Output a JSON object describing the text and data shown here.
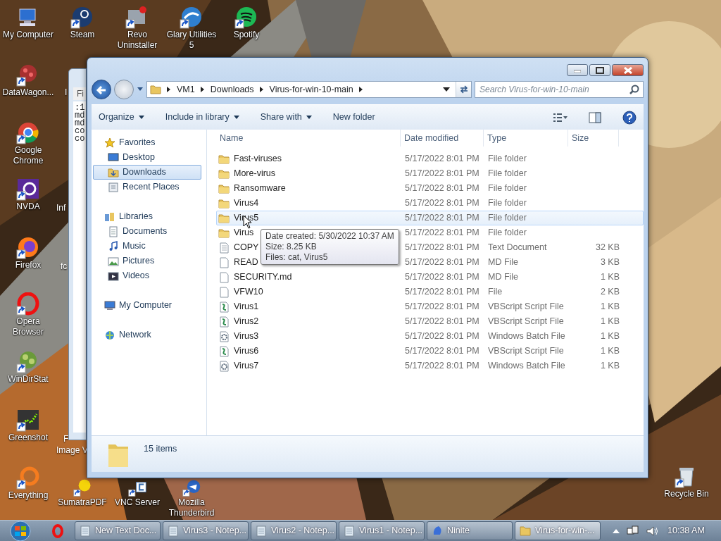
{
  "desktop": {
    "icons": [
      {
        "label": "My Computer"
      },
      {
        "label": "Steam"
      },
      {
        "label": "Revo Uninstaller"
      },
      {
        "label": "Glary Utilities 5"
      },
      {
        "label": "Spotify"
      },
      {
        "label": "DataWagon..."
      },
      {
        "label": "Google Chrome"
      },
      {
        "label": "NVDA"
      },
      {
        "label": "Firefox"
      },
      {
        "label": "Opera Browser"
      },
      {
        "label": "WinDirStat"
      },
      {
        "label": "Greenshot"
      },
      {
        "label": "Everything"
      },
      {
        "label": "SumatraPDF"
      },
      {
        "label": "VNC Server"
      },
      {
        "label": "Mozilla Thunderbird"
      },
      {
        "label": "Recycle Bin"
      }
    ],
    "partial_labels": [
      {
        "lines": [
          "I"
        ]
      },
      {
        "lines": [
          "Inf"
        ]
      },
      {
        "lines": [
          "fc"
        ]
      },
      {
        "lines": [
          "F",
          "Image V"
        ]
      }
    ]
  },
  "notepad_behind": {
    "menu": "Fi",
    "lines": [
      ":1",
      "md",
      "md",
      "co",
      "co"
    ]
  },
  "explorer": {
    "breadcrumb": [
      "VM1",
      "Downloads",
      "Virus-for-win-10-main"
    ],
    "search": {
      "placeholder": "Search Virus-for-win-10-main"
    },
    "toolbar": [
      {
        "label": "Organize",
        "dropdown": true
      },
      {
        "label": "Include in library",
        "dropdown": true
      },
      {
        "label": "Share with",
        "dropdown": true
      },
      {
        "label": "New folder",
        "dropdown": false
      }
    ],
    "nav": [
      {
        "label": "Favorites",
        "kind": "star",
        "selected": false,
        "children": [
          {
            "label": "Desktop",
            "kind": "desktop",
            "selected": false
          },
          {
            "label": "Downloads",
            "kind": "downloads",
            "selected": true
          },
          {
            "label": "Recent Places",
            "kind": "recent",
            "selected": false
          }
        ]
      },
      {
        "label": "Libraries",
        "kind": "library",
        "selected": false,
        "children": [
          {
            "label": "Documents",
            "kind": "documents",
            "selected": false
          },
          {
            "label": "Music",
            "kind": "music",
            "selected": false
          },
          {
            "label": "Pictures",
            "kind": "pictures",
            "selected": false
          },
          {
            "label": "Videos",
            "kind": "videos",
            "selected": false
          }
        ]
      },
      {
        "label": "My Computer",
        "kind": "computer",
        "selected": false
      },
      {
        "label": "Network",
        "kind": "network",
        "selected": false
      }
    ],
    "columns": [
      "Name",
      "Date modified",
      "Type",
      "Size"
    ],
    "rows": [
      {
        "kind": "folder",
        "name": "Fast-viruses",
        "date": "5/17/2022 8:01 PM",
        "type": "File folder",
        "hovered": false
      },
      {
        "kind": "folder",
        "name": "More-virus",
        "date": "5/17/2022 8:01 PM",
        "type": "File folder",
        "hovered": false
      },
      {
        "kind": "folder",
        "name": "Ransomware",
        "date": "5/17/2022 8:01 PM",
        "type": "File folder",
        "hovered": false
      },
      {
        "kind": "folder",
        "name": "Virus4",
        "date": "5/17/2022 8:01 PM",
        "type": "File folder",
        "hovered": false
      },
      {
        "kind": "folder",
        "name": "Virus5",
        "date": "5/17/2022 8:01 PM",
        "type": "File folder",
        "hovered": true
      },
      {
        "kind": "folder",
        "name": "Virus",
        "date": "5/17/2022 8:01 PM",
        "type": "File folder",
        "hovered": false
      },
      {
        "kind": "text",
        "name": "COPY",
        "date": "5/17/2022 8:01 PM",
        "type": "Text Document",
        "size": "32 KB",
        "hovered": false
      },
      {
        "kind": "file",
        "name": "READ",
        "date": "5/17/2022 8:01 PM",
        "type": "MD File",
        "size": "3 KB",
        "hovered": false
      },
      {
        "kind": "file",
        "name": "SECURITY.md",
        "date": "5/17/2022 8:01 PM",
        "type": "MD File",
        "size": "1 KB",
        "hovered": false
      },
      {
        "kind": "file",
        "name": "VFW10",
        "date": "5/17/2022 8:01 PM",
        "type": "File",
        "size": "2 KB",
        "hovered": false
      },
      {
        "kind": "script",
        "name": "Virus1",
        "date": "5/17/2022 8:01 PM",
        "type": "VBScript Script File",
        "size": "1 KB",
        "hovered": false
      },
      {
        "kind": "script",
        "name": "Virus2",
        "date": "5/17/2022 8:01 PM",
        "type": "VBScript Script File",
        "size": "1 KB",
        "hovered": false
      },
      {
        "kind": "batch",
        "name": "Virus3",
        "date": "5/17/2022 8:01 PM",
        "type": "Windows Batch File",
        "size": "1 KB",
        "hovered": false
      },
      {
        "kind": "script",
        "name": "Virus6",
        "date": "5/17/2022 8:01 PM",
        "type": "VBScript Script File",
        "size": "1 KB",
        "hovered": false
      },
      {
        "kind": "batch",
        "name": "Virus7",
        "date": "5/17/2022 8:01 PM",
        "type": "Windows Batch File",
        "size": "1 KB",
        "hovered": false
      }
    ],
    "tooltip": [
      "Date created: 5/30/2022 10:37 AM",
      "Size: 8.25 KB",
      "Files: cat, Virus5"
    ],
    "status": "15 items"
  },
  "taskbar": {
    "tasks": [
      {
        "kind": "notepad",
        "label": "New Text Doc...",
        "selected": false
      },
      {
        "kind": "notepad",
        "label": "Virus3 - Notep...",
        "selected": false
      },
      {
        "kind": "notepad",
        "label": "Virus2 - Notep...",
        "selected": false
      },
      {
        "kind": "notepad",
        "label": "Virus1 - Notep...",
        "selected": false
      },
      {
        "kind": "ninite",
        "label": "Ninite",
        "selected": false
      },
      {
        "kind": "folder",
        "label": "Virus-for-win-...",
        "selected": true
      }
    ],
    "clock": "10:38 AM"
  }
}
